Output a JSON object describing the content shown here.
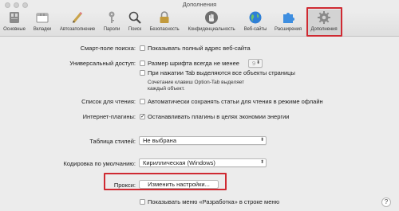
{
  "window": {
    "title": "Дополнения"
  },
  "toolbar": {
    "items": [
      {
        "label": "Основные",
        "icon": "switch-icon"
      },
      {
        "label": "Вкладки",
        "icon": "tabs-icon"
      },
      {
        "label": "Автозаполнение",
        "icon": "pencil-icon"
      },
      {
        "label": "Пароли",
        "icon": "key-icon"
      },
      {
        "label": "Поиск",
        "icon": "search-icon"
      },
      {
        "label": "Безопасность",
        "icon": "lock-icon"
      },
      {
        "label": "Конфиденциальность",
        "icon": "hand-icon"
      },
      {
        "label": "Веб-сайты",
        "icon": "globe-icon"
      },
      {
        "label": "Расширения",
        "icon": "puzzle-icon"
      },
      {
        "label": "Дополнения",
        "icon": "gear-icon"
      }
    ],
    "active": "Дополнения"
  },
  "settings": {
    "smart_search": {
      "label": "Смарт-поле поиска:",
      "option": "Показывать полный адрес веб-сайта",
      "checked": false
    },
    "accessibility": {
      "label": "Универсальный доступ:",
      "font_option": "Размер шрифта всегда не менее",
      "font_value": "9",
      "tab_option": "При нажатии Tab выделяются все объекты страницы",
      "hint_line1": "Сочетание клавиш Option-Tab выделяет",
      "hint_line2": "каждый объект."
    },
    "reading_list": {
      "label": "Список для чтения:",
      "option": "Автоматически сохранять статьи для чтения в режиме офлайн",
      "checked": false
    },
    "plugins": {
      "label": "Интернет-плагины:",
      "option": "Останавливать плагины в целях экономии энергии",
      "checked": true
    },
    "stylesheet": {
      "label": "Таблица стилей:",
      "value": "Не выбрана"
    },
    "encoding": {
      "label": "Кодировка по умолчанию:",
      "value": "Кириллическая (Windows)"
    },
    "proxies": {
      "label": "Прокси:",
      "button": "Изменить настройки..."
    },
    "develop_menu": {
      "option": "Показывать меню «Разработка» в строке меню",
      "checked": false
    }
  },
  "colors": {
    "highlight": "#cf2a32",
    "window_bg": "#ececec"
  }
}
